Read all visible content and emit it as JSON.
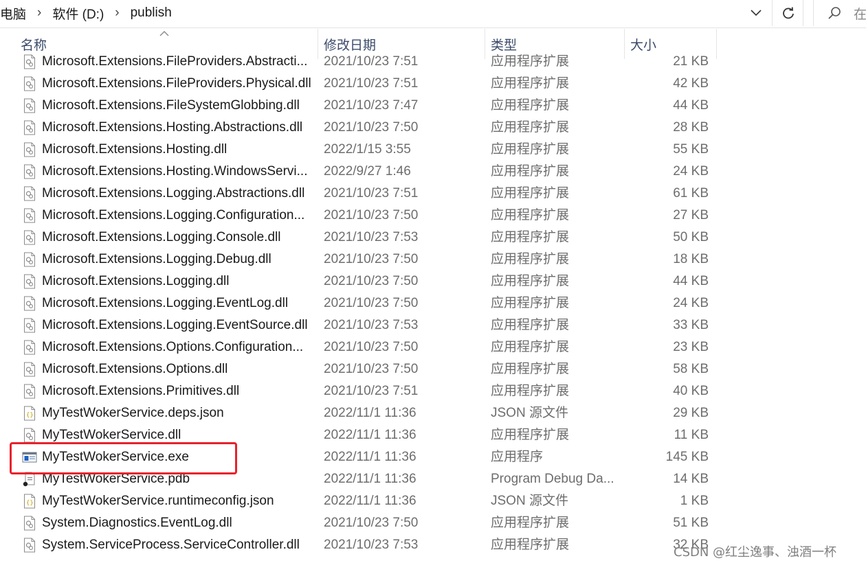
{
  "breadcrumb": [
    "电脑",
    "软件 (D:)",
    "publish"
  ],
  "search": {
    "placeholder": "在"
  },
  "columns": {
    "name": "名称",
    "date": "修改日期",
    "type": "类型",
    "size": "大小"
  },
  "files": [
    {
      "name": "Microsoft.Extensions.FileProviders.Abstracti...",
      "date": "2021/10/23 7:51",
      "type": "应用程序扩展",
      "size": "21 KB",
      "icon": "dll-icon"
    },
    {
      "name": "Microsoft.Extensions.FileProviders.Physical.dll",
      "date": "2021/10/23 7:51",
      "type": "应用程序扩展",
      "size": "42 KB",
      "icon": "dll-icon"
    },
    {
      "name": "Microsoft.Extensions.FileSystemGlobbing.dll",
      "date": "2021/10/23 7:47",
      "type": "应用程序扩展",
      "size": "44 KB",
      "icon": "dll-icon"
    },
    {
      "name": "Microsoft.Extensions.Hosting.Abstractions.dll",
      "date": "2021/10/23 7:50",
      "type": "应用程序扩展",
      "size": "28 KB",
      "icon": "dll-icon"
    },
    {
      "name": "Microsoft.Extensions.Hosting.dll",
      "date": "2022/1/15 3:55",
      "type": "应用程序扩展",
      "size": "55 KB",
      "icon": "dll-icon"
    },
    {
      "name": "Microsoft.Extensions.Hosting.WindowsServi...",
      "date": "2022/9/27 1:46",
      "type": "应用程序扩展",
      "size": "24 KB",
      "icon": "dll-icon"
    },
    {
      "name": "Microsoft.Extensions.Logging.Abstractions.dll",
      "date": "2021/10/23 7:51",
      "type": "应用程序扩展",
      "size": "61 KB",
      "icon": "dll-icon"
    },
    {
      "name": "Microsoft.Extensions.Logging.Configuration...",
      "date": "2021/10/23 7:50",
      "type": "应用程序扩展",
      "size": "27 KB",
      "icon": "dll-icon"
    },
    {
      "name": "Microsoft.Extensions.Logging.Console.dll",
      "date": "2021/10/23 7:53",
      "type": "应用程序扩展",
      "size": "50 KB",
      "icon": "dll-icon"
    },
    {
      "name": "Microsoft.Extensions.Logging.Debug.dll",
      "date": "2021/10/23 7:50",
      "type": "应用程序扩展",
      "size": "18 KB",
      "icon": "dll-icon"
    },
    {
      "name": "Microsoft.Extensions.Logging.dll",
      "date": "2021/10/23 7:50",
      "type": "应用程序扩展",
      "size": "44 KB",
      "icon": "dll-icon"
    },
    {
      "name": "Microsoft.Extensions.Logging.EventLog.dll",
      "date": "2021/10/23 7:50",
      "type": "应用程序扩展",
      "size": "24 KB",
      "icon": "dll-icon"
    },
    {
      "name": "Microsoft.Extensions.Logging.EventSource.dll",
      "date": "2021/10/23 7:53",
      "type": "应用程序扩展",
      "size": "33 KB",
      "icon": "dll-icon"
    },
    {
      "name": "Microsoft.Extensions.Options.Configuration...",
      "date": "2021/10/23 7:50",
      "type": "应用程序扩展",
      "size": "23 KB",
      "icon": "dll-icon"
    },
    {
      "name": "Microsoft.Extensions.Options.dll",
      "date": "2021/10/23 7:50",
      "type": "应用程序扩展",
      "size": "58 KB",
      "icon": "dll-icon"
    },
    {
      "name": "Microsoft.Extensions.Primitives.dll",
      "date": "2021/10/23 7:51",
      "type": "应用程序扩展",
      "size": "40 KB",
      "icon": "dll-icon"
    },
    {
      "name": "MyTestWokerService.deps.json",
      "date": "2022/11/1 11:36",
      "type": "JSON 源文件",
      "size": "29 KB",
      "icon": "json-icon"
    },
    {
      "name": "MyTestWokerService.dll",
      "date": "2022/11/1 11:36",
      "type": "应用程序扩展",
      "size": "11 KB",
      "icon": "dll-icon"
    },
    {
      "name": "MyTestWokerService.exe",
      "date": "2022/11/1 11:36",
      "type": "应用程序",
      "size": "145 KB",
      "icon": "exe-icon"
    },
    {
      "name": "MyTestWokerService.pdb",
      "date": "2022/11/1 11:36",
      "type": "Program Debug Da...",
      "size": "14 KB",
      "icon": "pdb-icon"
    },
    {
      "name": "MyTestWokerService.runtimeconfig.json",
      "date": "2022/11/1 11:36",
      "type": "JSON 源文件",
      "size": "1 KB",
      "icon": "json-icon"
    },
    {
      "name": "System.Diagnostics.EventLog.dll",
      "date": "2021/10/23 7:50",
      "type": "应用程序扩展",
      "size": "51 KB",
      "icon": "dll-icon"
    },
    {
      "name": "System.ServiceProcess.ServiceController.dll",
      "date": "2021/10/23 7:53",
      "type": "应用程序扩展",
      "size": "32 KB",
      "icon": "dll-icon"
    }
  ],
  "highlighted_file": "MyTestWokerService.exe",
  "highlight_color": "#e8212b",
  "watermark": "CSDN @红尘逸事、浊酒一杯"
}
